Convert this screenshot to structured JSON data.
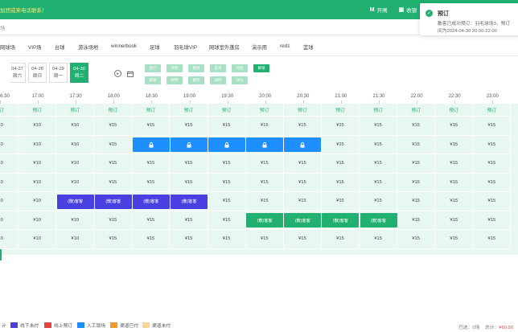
{
  "topbar": {
    "notice": "加团或来电话联系！",
    "tools": [
      {
        "icon": "flag-icon",
        "glyph": "M",
        "label": "开闸"
      },
      {
        "icon": "wallet-icon",
        "glyph": "▣",
        "label": "收银"
      },
      {
        "icon": "home-icon",
        "glyph": "⌂",
        "label": "租"
      }
    ]
  },
  "search": {
    "value": "场"
  },
  "venue_tabs": [
    "网球场",
    "VIP场",
    "台球",
    "游泳场地",
    "winnerbook",
    "足球",
    "羽毛球VIP",
    "网球室外蓬房",
    "演示用",
    "red1",
    "篮球"
  ],
  "dates": [
    {
      "date": "04-27",
      "weekday": "周六",
      "active": false
    },
    {
      "date": "04-28",
      "weekday": "周日",
      "active": false
    },
    {
      "date": "04-29",
      "weekday": "周一",
      "active": false
    },
    {
      "date": "04-30",
      "weekday": "周二",
      "active": true
    }
  ],
  "filters": [
    {
      "label": "预订",
      "active": false
    },
    {
      "label": "修改",
      "active": false
    },
    {
      "label": "锁场",
      "active": false
    },
    {
      "label": "取消",
      "active": false
    },
    {
      "label": "付款",
      "active": false
    },
    {
      "label": "解锁",
      "active": true
    },
    {
      "label": "解锁",
      "active": false
    },
    {
      "label": "购物",
      "active": false
    },
    {
      "label": "换场",
      "active": false
    },
    {
      "label": "加时",
      "active": false
    },
    {
      "label": "详付",
      "active": false
    }
  ],
  "time_labels": [
    "6:30",
    "17:00",
    "17:30",
    "18:00",
    "18:30",
    "19:00",
    "19:30",
    "20:00",
    "20:30",
    "21:00",
    "21:30",
    "22:00",
    "22:30",
    "23:00"
  ],
  "grid": {
    "header_label": "预订",
    "rows": [
      {
        "cells": [
          "¥10",
          "¥10",
          "¥10",
          "¥15",
          "¥15",
          "¥15",
          "¥15",
          "¥15",
          "¥15",
          "¥15",
          "¥15",
          "¥15",
          "¥15",
          "¥15"
        ]
      },
      {
        "cells": [
          "¥10",
          "¥10",
          "¥10",
          "¥15",
          "",
          "",
          "",
          "",
          "",
          "¥15",
          "¥15",
          "¥15",
          "¥15",
          "¥15"
        ]
      },
      {
        "cells": [
          "¥10",
          "¥10",
          "¥10",
          "¥15",
          "¥15",
          "¥15",
          "¥15",
          "¥15",
          "¥15",
          "¥15",
          "¥15",
          "¥15",
          "¥15",
          "¥15"
        ]
      },
      {
        "cells": [
          "¥10",
          "¥10",
          "¥10",
          "¥15",
          "¥15",
          "¥15",
          "¥15",
          "¥15",
          "¥15",
          "¥15",
          "¥15",
          "¥15",
          "¥15",
          "¥15"
        ]
      },
      {
        "cells": [
          "¥10",
          "¥10",
          "",
          "",
          "",
          "",
          "¥15",
          "¥15",
          "¥15",
          "¥15",
          "¥15",
          "¥15",
          "¥15",
          "¥15"
        ]
      },
      {
        "cells": [
          "¥10",
          "¥10",
          "¥10",
          "¥15",
          "¥15",
          "¥15",
          "¥15",
          "",
          "",
          "",
          "",
          "¥15",
          "¥15",
          "¥15"
        ]
      },
      {
        "cells": [
          "¥10",
          "¥10",
          "¥10",
          "¥15",
          "¥15",
          "¥15",
          "¥15",
          "¥15",
          "¥15",
          "¥15",
          "¥15",
          "¥15",
          "¥15",
          "¥15"
        ]
      }
    ],
    "booking_label": "(散)客客"
  },
  "legend": [
    {
      "label": "计",
      "color": ""
    },
    {
      "label": "线下未付",
      "color": "#4a3fe0"
    },
    {
      "label": "线上预订",
      "color": "#e24343"
    },
    {
      "label": "人工锁场",
      "color": "#1e8fff"
    },
    {
      "label": "渠道已付",
      "color": "#ef9a2a"
    },
    {
      "label": "渠道未付",
      "color": "#f6d79a"
    }
  ],
  "summary": {
    "selected": "已选：0场",
    "total_label": "总计：",
    "total_value": "¥60.00"
  },
  "toast": {
    "title": "预订",
    "message1": "散客已成功预订：羽毛球场3，预订",
    "message2": "间为2024-04-30 20:00-22:00"
  }
}
